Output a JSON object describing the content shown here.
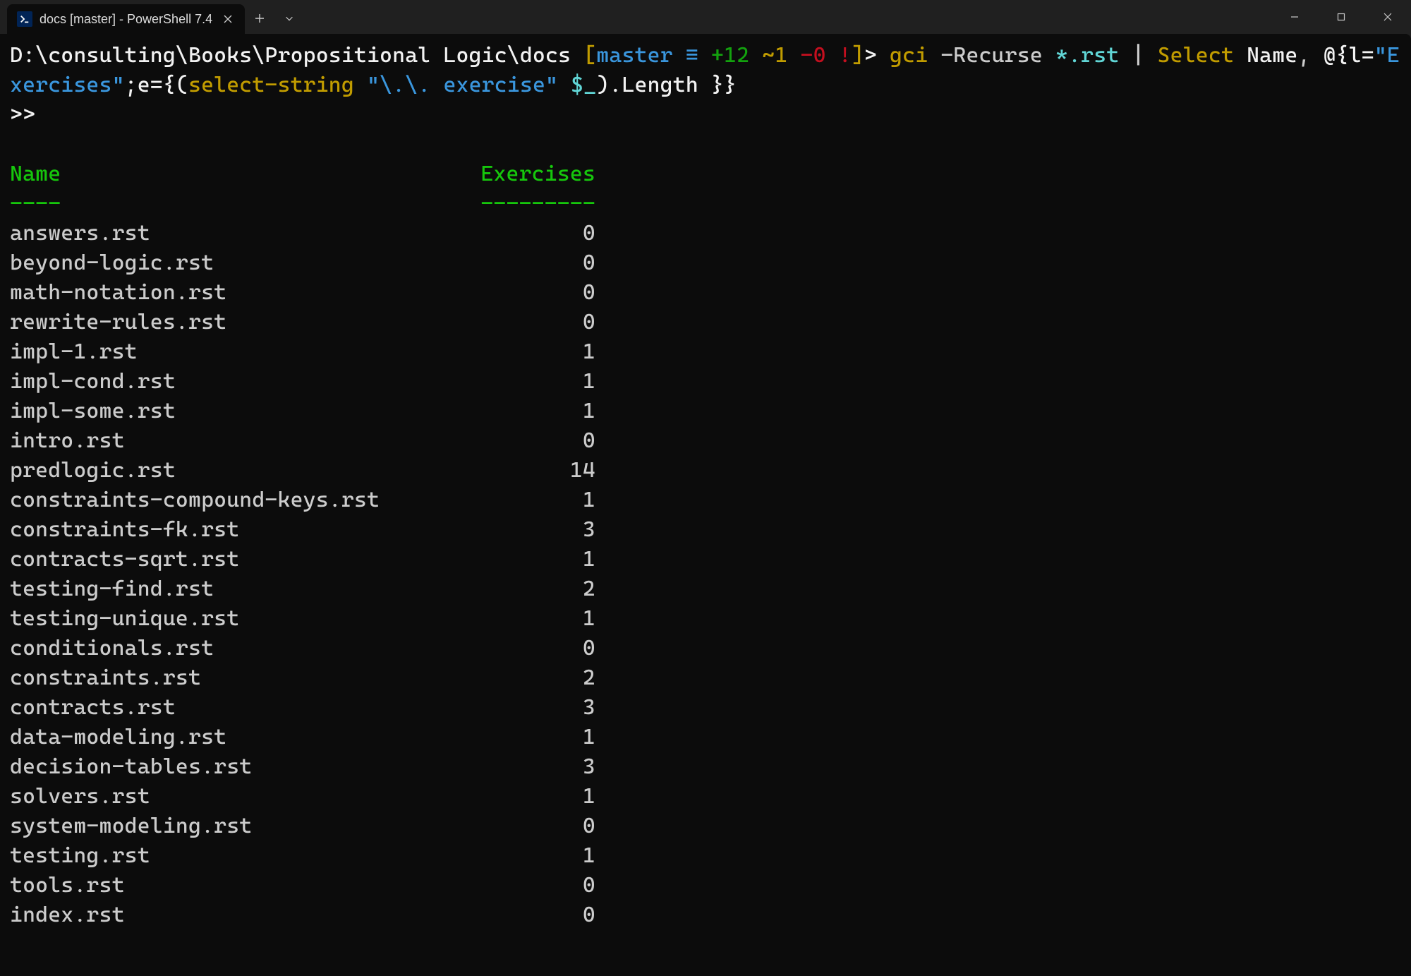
{
  "tab": {
    "title": "docs [master] - PowerShell 7.4"
  },
  "prompt": {
    "path": "D:\\consulting\\Books\\Propositional Logic\\docs",
    "branch": "master",
    "identical": "≡",
    "ahead": "+12",
    "behind": "~1",
    "gone": "-0",
    "dirty": "!",
    "command_parts": {
      "p1": "gci",
      "p2": "-Recurse",
      "p3": "*.rst",
      "p4": "|",
      "p5": "Select",
      "p6": "Name",
      "p7": ",",
      "p8": "@{l=",
      "p9": "\"Exercises\"",
      "p10": ";e={(",
      "p11": "select-string",
      "p12": "\"\\.\\. exercise\"",
      "p13": "$_",
      "p14": ").Length }}"
    },
    "continuation": ">>"
  },
  "headers": {
    "name": "Name",
    "exercises": "Exercises",
    "name_ul": "----",
    "ex_ul": "---------"
  },
  "rows": [
    {
      "name": "answers.rst",
      "ex": "0"
    },
    {
      "name": "beyond-logic.rst",
      "ex": "0"
    },
    {
      "name": "math-notation.rst",
      "ex": "0"
    },
    {
      "name": "rewrite-rules.rst",
      "ex": "0"
    },
    {
      "name": "impl-1.rst",
      "ex": "1"
    },
    {
      "name": "impl-cond.rst",
      "ex": "1"
    },
    {
      "name": "impl-some.rst",
      "ex": "1"
    },
    {
      "name": "intro.rst",
      "ex": "0"
    },
    {
      "name": "predlogic.rst",
      "ex": "14"
    },
    {
      "name": "constraints-compound-keys.rst",
      "ex": "1"
    },
    {
      "name": "constraints-fk.rst",
      "ex": "3"
    },
    {
      "name": "contracts-sqrt.rst",
      "ex": "1"
    },
    {
      "name": "testing-find.rst",
      "ex": "2"
    },
    {
      "name": "testing-unique.rst",
      "ex": "1"
    },
    {
      "name": "conditionals.rst",
      "ex": "0"
    },
    {
      "name": "constraints.rst",
      "ex": "2"
    },
    {
      "name": "contracts.rst",
      "ex": "3"
    },
    {
      "name": "data-modeling.rst",
      "ex": "1"
    },
    {
      "name": "decision-tables.rst",
      "ex": "3"
    },
    {
      "name": "solvers.rst",
      "ex": "1"
    },
    {
      "name": "system-modeling.rst",
      "ex": "0"
    },
    {
      "name": "testing.rst",
      "ex": "1"
    },
    {
      "name": "tools.rst",
      "ex": "0"
    },
    {
      "name": "index.rst",
      "ex": "0"
    }
  ]
}
